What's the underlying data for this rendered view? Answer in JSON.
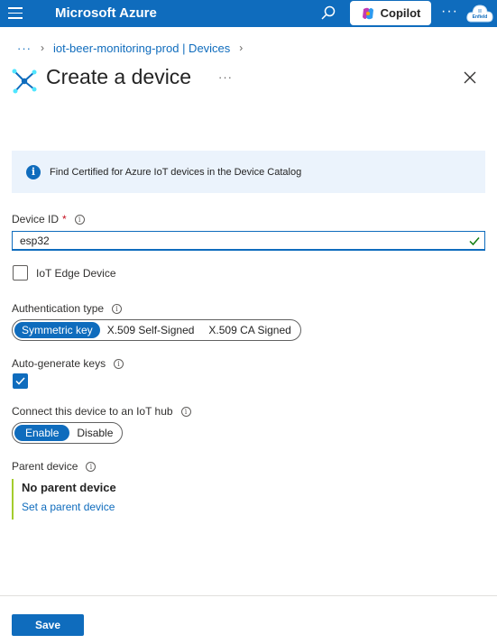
{
  "topbar": {
    "brand": "Microsoft Azure",
    "copilot_label": "Copilot",
    "more_label": "···",
    "avatar_text": "Enfield",
    "bg_color": "#0f6cbd"
  },
  "breadcrumb": {
    "overflow": "···",
    "items": [
      {
        "label": "iot-beer-monitoring-prod | Devices"
      }
    ]
  },
  "header": {
    "title": "Create a device",
    "more_label": "···",
    "icon": "iot-hub-device-icon"
  },
  "info_banner": {
    "text": "Find Certified for Azure IoT devices in the Device Catalog",
    "icon": "info-icon"
  },
  "form": {
    "device_id": {
      "label": "Device ID",
      "required_mark": "*",
      "value": "esp32",
      "valid": true
    },
    "iot_edge": {
      "label": "IoT Edge Device",
      "checked": false
    },
    "auth_type": {
      "label": "Authentication type",
      "options": [
        "Symmetric key",
        "X.509 Self-Signed",
        "X.509 CA Signed"
      ],
      "selected": "Symmetric key"
    },
    "auto_generate": {
      "label": "Auto-generate keys",
      "checked": true
    },
    "connect": {
      "label": "Connect this device to an IoT hub",
      "options": [
        "Enable",
        "Disable"
      ],
      "selected": "Enable"
    },
    "parent": {
      "label": "Parent device",
      "value": "No parent device",
      "link": "Set a parent device"
    }
  },
  "footer": {
    "save_label": "Save"
  },
  "colors": {
    "accent": "#0f6cbd",
    "valid": "#107c10",
    "parent_bar": "#a4cc2d",
    "required": "#c50f1f"
  }
}
